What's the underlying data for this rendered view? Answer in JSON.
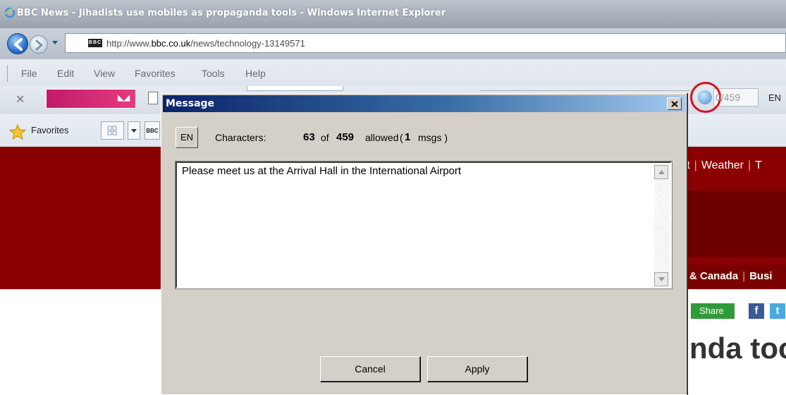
{
  "window": {
    "title": "BBC News - Jihadists use mobiles as propaganda tools - Windows Internet Explorer"
  },
  "address": {
    "url_prefix": "http://www.",
    "url_domain": "bbc.co.uk",
    "url_path": "/news/technology-13149571",
    "favicon_text": "BBC"
  },
  "menu": {
    "items": [
      "File",
      "Edit",
      "View",
      "Favorites",
      "Tools",
      "Help"
    ]
  },
  "toolbar": {
    "counter": "0/459",
    "language": "EN"
  },
  "favorites": {
    "label": "Favorites"
  },
  "page": {
    "nav_items": [
      "ort",
      "Weather",
      "T"
    ],
    "region_items": [
      "& Canada",
      "Busi"
    ],
    "share_label": "Share",
    "facebook_label": "f",
    "twitter_label": "t",
    "headline": "nda too"
  },
  "dialog": {
    "title": "Message",
    "language_button": "EN",
    "characters_label": "Characters:",
    "char_count": "63",
    "of_label": "of",
    "char_max": "459",
    "allowed_label": "allowed",
    "paren_open": "(",
    "msgs_count": "1",
    "msgs_label": "msgs )",
    "message_text": "Please meet us at the Arrival Hall in the International Airport",
    "cancel_button": "Cancel",
    "apply_button": "Apply"
  },
  "colors": {
    "dialog_title_start": "#0a246a",
    "dialog_title_end": "#a6caf0",
    "bbc_red": "#8a0000",
    "highlight_circle": "#d80f1b"
  },
  "icons": {
    "back": "back-arrow-icon",
    "forward": "forward-arrow-icon",
    "favorites_star": "star-icon",
    "close": "close-icon"
  }
}
